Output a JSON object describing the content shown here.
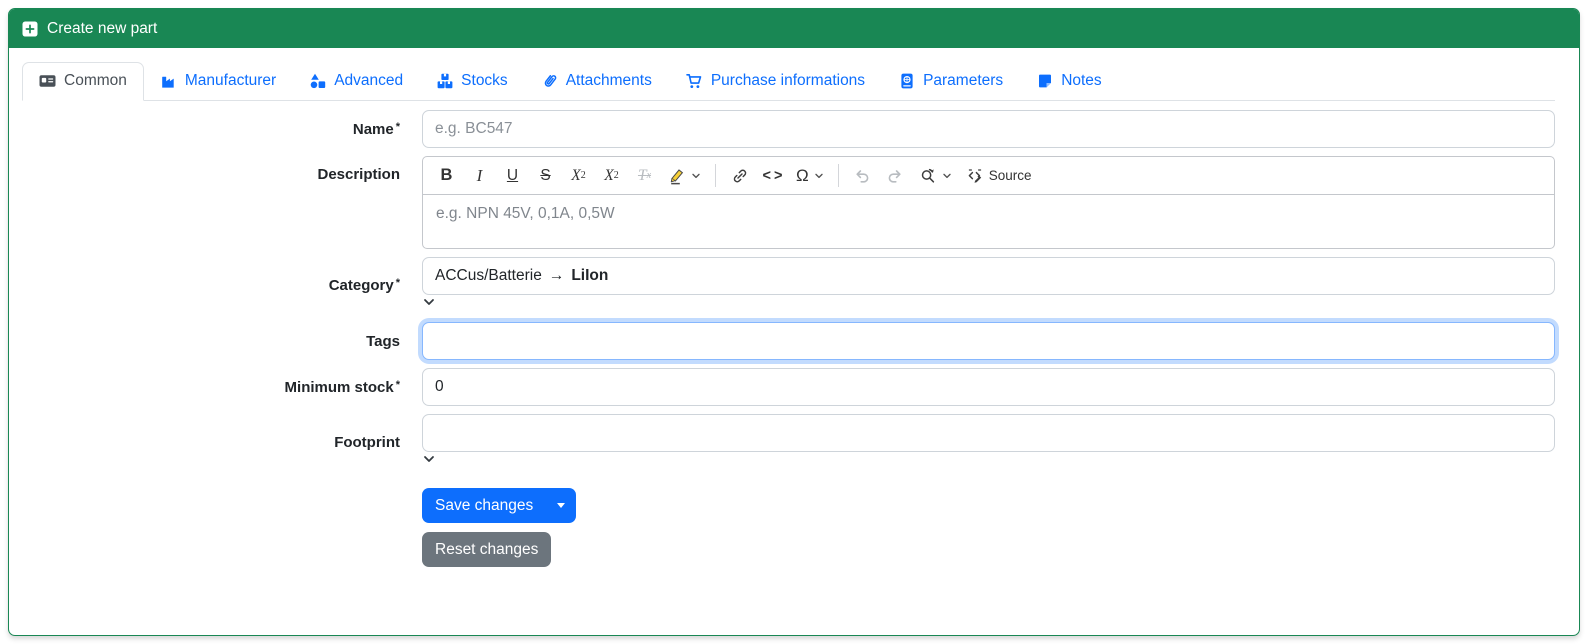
{
  "header": {
    "title": "Create new part"
  },
  "required_marker": "*",
  "tabs": [
    {
      "label": "Common",
      "active": true
    },
    {
      "label": "Manufacturer"
    },
    {
      "label": "Advanced"
    },
    {
      "label": "Stocks"
    },
    {
      "label": "Attachments"
    },
    {
      "label": "Purchase informations"
    },
    {
      "label": "Parameters"
    },
    {
      "label": "Notes"
    }
  ],
  "form": {
    "name": {
      "label": "Name",
      "placeholder": "e.g. BC547",
      "value": ""
    },
    "description": {
      "label": "Description",
      "placeholder": "e.g. NPN 45V, 0,1A, 0,5W",
      "value": ""
    },
    "category": {
      "label": "Category",
      "path": "ACCus/Batterie",
      "arrow": "→",
      "selected": "LiIon"
    },
    "tags": {
      "label": "Tags",
      "value": "",
      "focused": true
    },
    "minimum_stock": {
      "label": "Minimum stock",
      "value": "0"
    },
    "footprint": {
      "label": "Footprint",
      "value": ""
    }
  },
  "editor_toolbar": {
    "bold": "B",
    "italic": "I",
    "underline": "U",
    "strikethrough": "S",
    "subscript_base": "X",
    "subscript_mark": "2",
    "superscript_base": "X",
    "superscript_mark": "2",
    "remove_format_base": "T",
    "remove_format_mark": "x",
    "code": "<>",
    "special_characters": "Ω",
    "source_label": "Source"
  },
  "buttons": {
    "save": "Save changes",
    "reset": "Reset changes"
  },
  "colors": {
    "header_green": "#198754",
    "link_blue": "#0d6efd",
    "button_primary": "#0d6efd",
    "button_secondary": "#6c757d",
    "focus_ring": "#86b7fe",
    "highlight_pen_yellow": "#f7d038"
  }
}
